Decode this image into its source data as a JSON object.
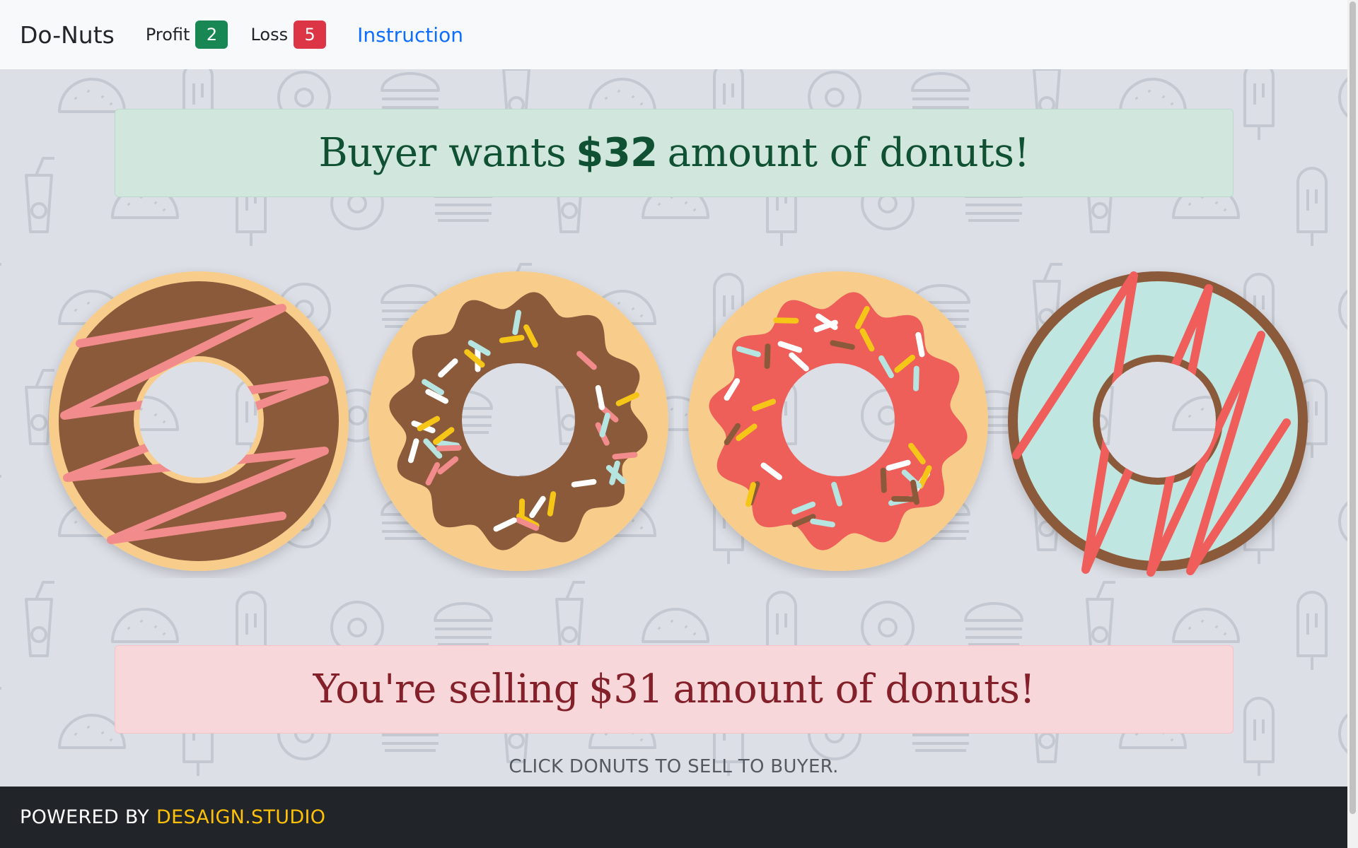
{
  "navbar": {
    "brand": "Do-Nuts",
    "profit_label": "Profit",
    "profit_value": "2",
    "loss_label": "Loss",
    "loss_value": "5",
    "instruction_link": "Instruction"
  },
  "buyer_alert": {
    "prefix": "Buyer wants",
    "amount": "$32",
    "suffix": "amount of donuts!"
  },
  "seller_alert": {
    "prefix": "You're selling",
    "amount": "$31",
    "suffix": "amount of donuts!"
  },
  "donuts": [
    {
      "name": "chocolate-zigzag",
      "dough": "#f8cd8c",
      "glaze": "#8b5a3a",
      "accent": "#f28b8b"
    },
    {
      "name": "chocolate-sprinkles",
      "dough": "#f8cd8c",
      "glaze": "#8b5a3a",
      "accent": "#ffffff"
    },
    {
      "name": "strawberry-sprinkles",
      "dough": "#f8cd8c",
      "glaze": "#ef5e5a",
      "accent": "#ffffff"
    },
    {
      "name": "mint-zigzag",
      "dough": "#8b5a3a",
      "glaze": "#bfe6e1",
      "accent": "#ef5e5a"
    }
  ],
  "hint": "CLICK DONUTS TO SELL TO BUYER.",
  "footer": {
    "prefix": "POWERED BY",
    "studio": "DESAIGN.STUDIO"
  },
  "colors": {
    "profit_badge": "#198754",
    "loss_badge": "#dc3545",
    "link": "#0d6efd",
    "footer_accent": "#ffc107"
  }
}
